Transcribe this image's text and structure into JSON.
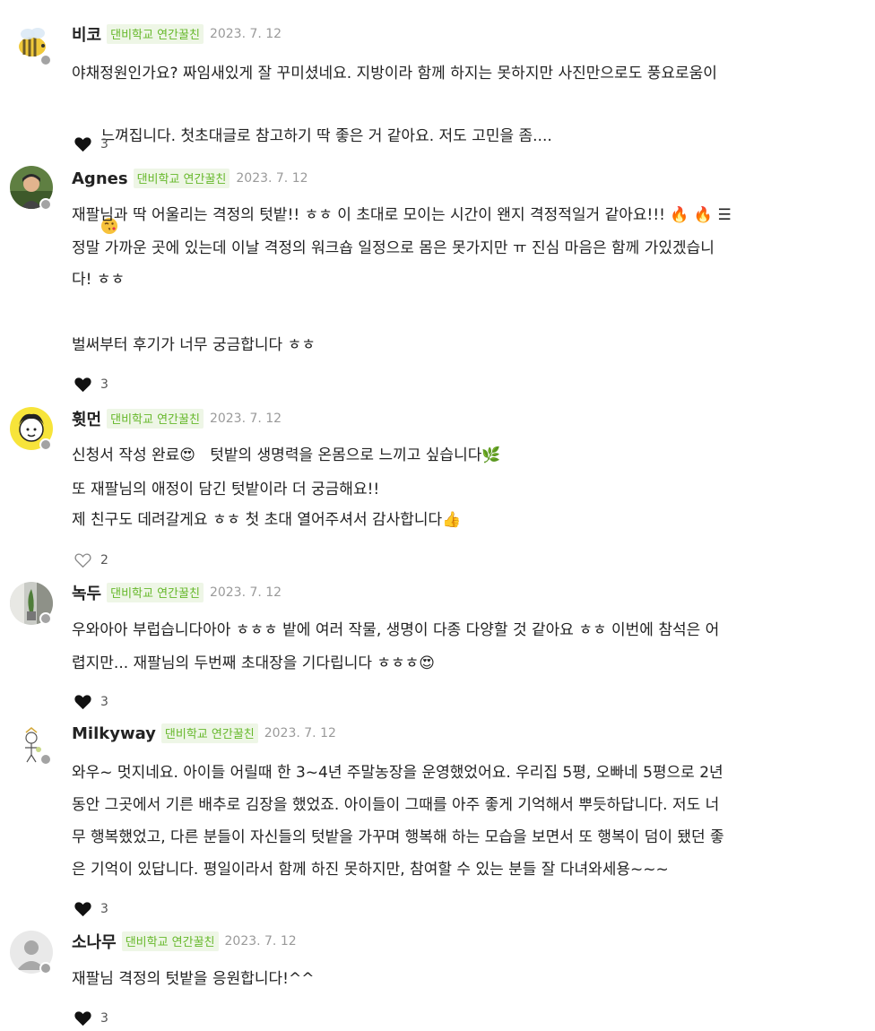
{
  "comments": [
    {
      "author": "비코",
      "badge": "댄비학교 연간꿀친",
      "date": "2023. 7. 12",
      "avatar_icon": "bee-avatar",
      "text": [
        "야채정원인가요? 짜임새있게 잘 꾸미셨네요. 지방이라 함께 하지는 못하지만 사진만으로도 풍요로움이",
        "느껴집니다. 첫초대글로 참고하기 딱 좋은 거 같아요. 저도 고민을 좀...."
      ],
      "emoji": "kissing-face-emoji",
      "likes": "3",
      "liked": true
    },
    {
      "author": "Agnes",
      "badge": "댄비학교 연간꿀친",
      "date": "2023. 7. 12",
      "avatar_icon": "photo-avatar",
      "text": [
        "재팔님과 딱 어울리는 격정의 텃밭!! ㅎㅎ 이 초대로 모이는 시간이 왠지 격정적일거 같아요!!! 🔥 🔥 ☰",
        "정말 가까운 곳에 있는데 이날 격정의 워크숍 일정으로 몸은 못가지만 ㅠ 진심 마음은 함께 가있겠습니",
        "다! ㅎㅎ",
        "",
        "벌써부터 후기가 너무 궁금합니다 ㅎㅎ"
      ],
      "likes": "3",
      "liked": true
    },
    {
      "author": "휫먼",
      "badge": "댄비학교 연간꿀친",
      "date": "2023. 7. 12",
      "avatar_icon": "drawn-face-avatar",
      "text": [
        "신청서 작성 완료😍   텃밭의 생명력을 온몸으로 느끼고 싶습니다🌿",
        "또 재팔님의 애정이 담긴 텃밭이라 더 궁금해요!!",
        "제 친구도 데려갈게요 ㅎㅎ 첫 초대 열어주셔서 감사합니다👍"
      ],
      "likes": "2",
      "liked": false
    },
    {
      "author": "녹두",
      "badge": "댄비학교 연간꿀친",
      "date": "2023. 7. 12",
      "avatar_icon": "plant-photo-avatar",
      "text": [
        "우와아아 부럽습니다아아 ㅎㅎㅎ 밭에 여러 작물, 생명이 다종 다양할 것 같아요 ㅎㅎ 이번에 참석은 어",
        "렵지만... 재팔님의 두번째 초대장을 기다립니다 ㅎㅎㅎ😍"
      ],
      "likes": "3",
      "liked": true
    },
    {
      "author": "Milkyway",
      "badge": "댄비학교 연간꿀친",
      "date": "2023. 7. 12",
      "avatar_icon": "doodle-avatar",
      "text": [
        "와우~ 멋지네요. 아이들 어릴때 한 3~4년 주말농장을 운영했었어요. 우리집 5평, 오빠네 5평으로 2년",
        "동안 그곳에서 기른 배추로 김장을 했었죠. 아이들이 그때를 아주 좋게 기억해서 뿌듯하답니다. 저도 너",
        "무 행복했었고, 다른 분들이 자신들의 텃밭을 가꾸며 행복해 하는 모습을 보면서 또 행복이 덤이 됐던 좋",
        "은 기억이 있답니다. 평일이라서 함께 하진 못하지만, 참여할 수 있는 분들 잘 다녀와세용~~~"
      ],
      "likes": "3",
      "liked": true
    },
    {
      "author": "소나무",
      "badge": "댄비학교 연간꿀친",
      "date": "2023. 7. 12",
      "avatar_icon": "default-user-avatar",
      "text": [
        "재팔님 격정의 텃밭을 응원합니다!^^"
      ],
      "likes": "3",
      "liked": true
    }
  ]
}
